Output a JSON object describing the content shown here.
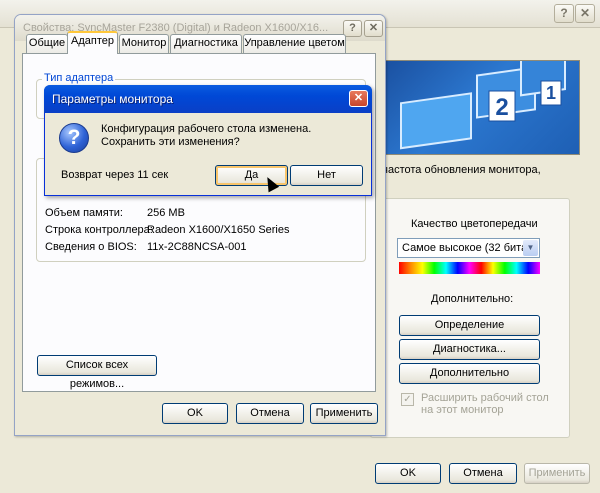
{
  "background_window": {
    "title": "",
    "preview_badge_1": "2",
    "preview_badge_2": "1",
    "description": "и, частота обновления монитора,",
    "color_quality_label": "Качество цветопередачи",
    "color_quality_value": "Самое высокое (32 бита)",
    "advanced_label": "Дополнительно:",
    "identify_button": "Определение",
    "diagnostics_button": "Диагностика...",
    "advanced_button": "Дополнительно",
    "extend_checkbox_line1": "Расширить рабочий стол",
    "extend_checkbox_line2": "на этот монитор",
    "extend_checked": true,
    "ok_button": "OK",
    "cancel_button": "Отмена",
    "apply_button": "Применить"
  },
  "adapter_window": {
    "title": "Свойства: SyncMaster F2380 (Digital) и Radeon X1600/X16...",
    "tabs": [
      "Общие",
      "Адаптер",
      "Монитор",
      "Диагностика",
      "Управление цветом"
    ],
    "active_tab": "Адаптер",
    "adapter_group_label": "Тип адаптера",
    "info_rows": [
      {
        "label": "Объем памяти:",
        "value": "256 MB"
      },
      {
        "label": "Строка контроллера:",
        "value": "Radeon X1600/X1650 Series"
      },
      {
        "label": "Сведения о BIOS:",
        "value": "11x-2C88NCSA-001"
      }
    ],
    "list_modes_button": "Список всех режимов...",
    "ok_button": "OK",
    "cancel_button": "Отмена",
    "apply_button": "Применить"
  },
  "dialog": {
    "title": "Параметры монитора",
    "message": "Конфигурация рабочего стола изменена. Сохранить эти изменения?",
    "countdown": "Возврат через 11 сек",
    "yes_button": "Да",
    "no_button": "Нет"
  }
}
